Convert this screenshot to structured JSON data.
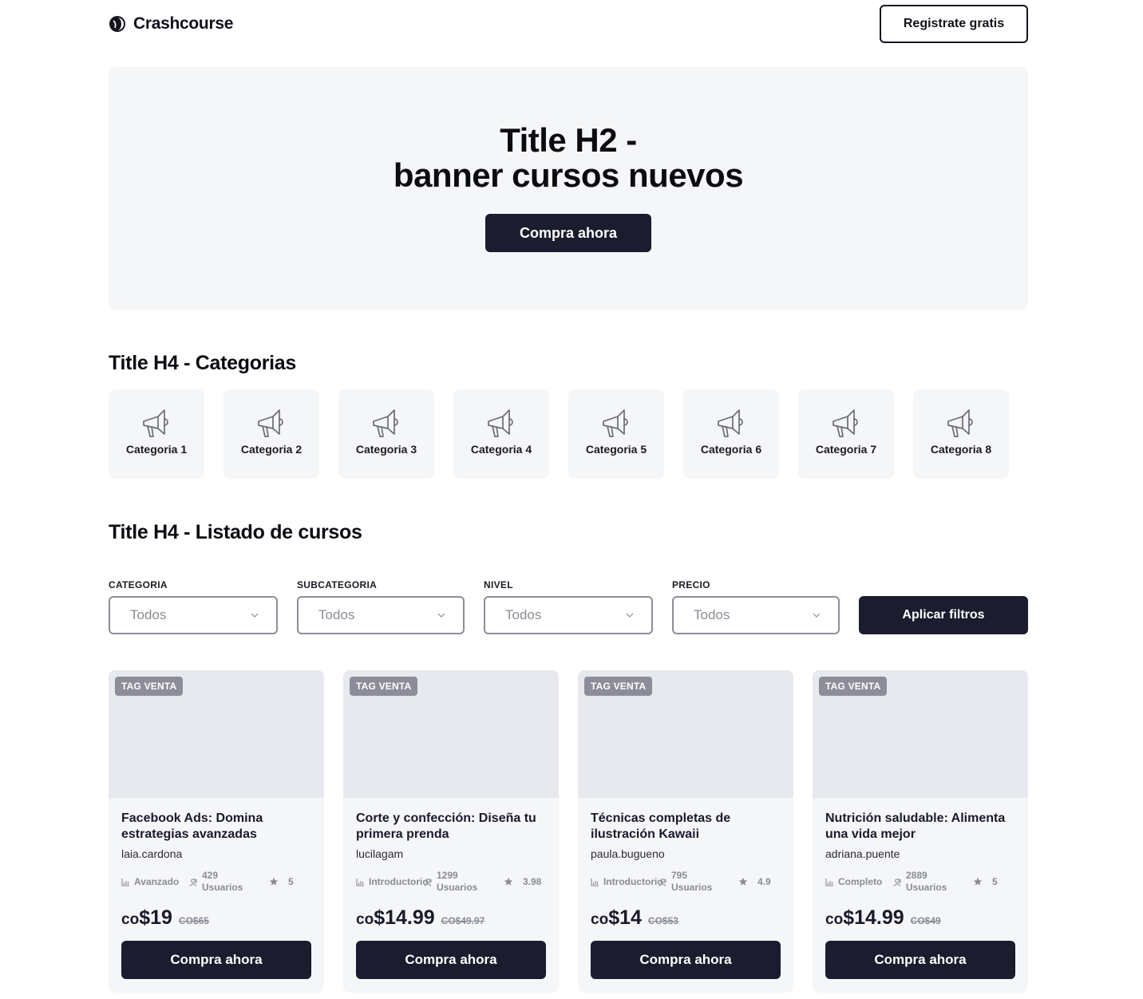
{
  "header": {
    "logo_text": "Crashcourse",
    "register_label": "Registrate gratis"
  },
  "banner": {
    "title_line1": "Title H2 -",
    "title_line2": "banner cursos nuevos",
    "cta_label": "Compra ahora"
  },
  "categories_section": {
    "title": "Title H4 - Categorias",
    "icon": "megaphone-icon",
    "items": [
      {
        "label": "Categoria 1"
      },
      {
        "label": "Categoria 2"
      },
      {
        "label": "Categoria 3"
      },
      {
        "label": "Categoria 4"
      },
      {
        "label": "Categoria 5"
      },
      {
        "label": "Categoria 6"
      },
      {
        "label": "Categoria 7"
      },
      {
        "label": "Categoria 8"
      }
    ]
  },
  "courses_section": {
    "title": "Title H4 - Listado de cursos"
  },
  "filters": {
    "items": [
      {
        "label": "CATEGORIA",
        "value": "Todos"
      },
      {
        "label": "SUBCATEGORIA",
        "value": "Todos"
      },
      {
        "label": "NIVEL",
        "value": "Todos"
      },
      {
        "label": "PRECIO",
        "value": "Todos"
      }
    ],
    "apply_label": "Aplicar filtros"
  },
  "courses": [
    {
      "tag": "TAG VENTA",
      "title": "Facebook Ads: Domina estrategias avanzadas",
      "author": "laia.cardona",
      "level": "Avanzado",
      "users_count": "429",
      "users_label": "Usuarios",
      "rating": "5",
      "currency": "co",
      "price": "$19",
      "old_price": "CO$65",
      "cta_label": "Compra ahora"
    },
    {
      "tag": "TAG VENTA",
      "title": "Corte y confección: Diseña tu primera prenda",
      "author": "lucilagam",
      "level": "Introductorio",
      "users_count": "1299",
      "users_label": "Usuarios",
      "rating": "3.98",
      "currency": "co",
      "price": "$14.99",
      "old_price": "CO$49.97",
      "cta_label": "Compra ahora"
    },
    {
      "tag": "TAG VENTA",
      "title": "Técnicas completas de ilustración Kawaii",
      "author": "paula.bugueno",
      "level": "Introductorio",
      "users_count": "795",
      "users_label": "Usuarios",
      "rating": "4.9",
      "currency": "co",
      "price": "$14",
      "old_price": "CO$53",
      "cta_label": "Compra ahora"
    },
    {
      "tag": "TAG VENTA",
      "title": "Nutrición saludable: Alimenta una vida mejor",
      "author": "adriana.puente",
      "level": "Completo",
      "users_count": "2889",
      "users_label": "Usuarios",
      "rating": "5",
      "currency": "co",
      "price": "$14.99",
      "old_price": "CO$49",
      "cta_label": "Compra ahora"
    }
  ],
  "colors": {
    "primary_dark": "#1b1c2e",
    "panel_bg": "#f5f6f8",
    "thumb_bg": "#e8e9ee",
    "muted_text": "#8a8b95",
    "tag_bg": "#8c8d99"
  }
}
